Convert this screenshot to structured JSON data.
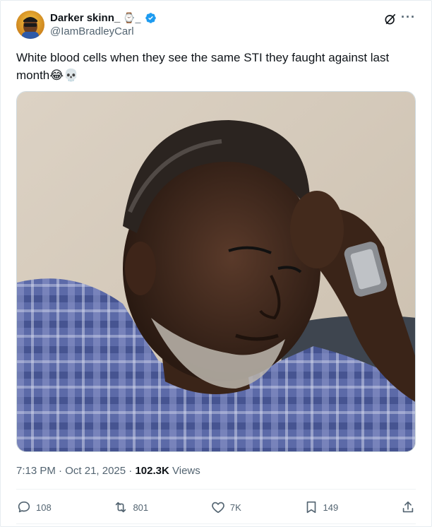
{
  "author": {
    "display_name": "Darker skinn_",
    "name_emoji": "⌚_",
    "handle": "@IamBradleyCarl",
    "verified": true,
    "avatar_icon": "profile-avatar"
  },
  "header_actions": {
    "grok_icon": "grok-icon",
    "more_icon": "more-icon"
  },
  "tweet": {
    "text": "White blood cells when they see the same STI they faught against last month",
    "emoji_laugh": "😂",
    "emoji_skull": "💀"
  },
  "media": {
    "icon": "photo-image"
  },
  "meta": {
    "time": "7:13 PM",
    "sep1": "·",
    "date": "Oct 21, 2025",
    "sep2": "·",
    "views_count": "102.3K",
    "views_label": "Views"
  },
  "actions": {
    "replies": "108",
    "reposts": "801",
    "likes": "7K",
    "bookmarks": "149"
  },
  "colors": {
    "text_primary": "#0f1419",
    "text_secondary": "#536471",
    "verified_blue": "#1d9bf0",
    "border": "#cfd9de"
  }
}
